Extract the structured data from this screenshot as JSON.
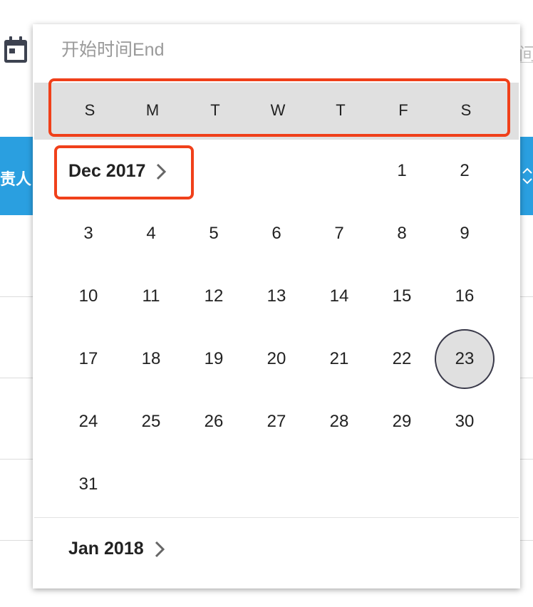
{
  "background": {
    "column_header_partial": "责人",
    "end_input_partial": "间"
  },
  "popup": {
    "input_placeholder": "开始时间End",
    "weekdays": [
      "S",
      "M",
      "T",
      "W",
      "T",
      "F",
      "S"
    ],
    "months": [
      {
        "label": "Dec 2017",
        "first_weekday": 5,
        "days": 31
      },
      {
        "label": "Jan 2018"
      }
    ],
    "selected_day": "23",
    "dec_days": [
      "1",
      "2",
      "3",
      "4",
      "5",
      "6",
      "7",
      "8",
      "9",
      "10",
      "11",
      "12",
      "13",
      "14",
      "15",
      "16",
      "17",
      "18",
      "19",
      "20",
      "21",
      "22",
      "23",
      "24",
      "25",
      "26",
      "27",
      "28",
      "29",
      "30",
      "31"
    ]
  },
  "colors": {
    "accent_blue": "#2a9fe0",
    "highlight_red": "#f0401a",
    "weekday_bg": "#e0e0e0"
  }
}
